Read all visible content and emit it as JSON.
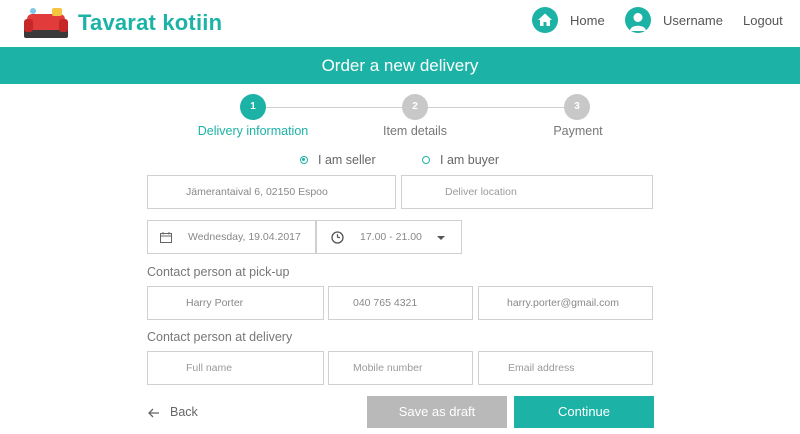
{
  "header": {
    "brand": "Tavarat kotiin",
    "nav": {
      "home": "Home",
      "username": "Username",
      "logout": "Logout"
    }
  },
  "banner": {
    "title": "Order a new delivery"
  },
  "stepper": {
    "steps": [
      {
        "number": "1",
        "label": "Delivery information",
        "state": "active"
      },
      {
        "number": "2",
        "label": "Item details",
        "state": "inactive"
      },
      {
        "number": "3",
        "label": "Payment",
        "state": "inactive"
      }
    ]
  },
  "role": {
    "options": [
      {
        "label": "I am seller",
        "checked": true
      },
      {
        "label": "I am buyer",
        "checked": false
      }
    ]
  },
  "locations": {
    "pickup": {
      "value": "Jämerantaival 6, 02150 Espoo",
      "placeholder": ""
    },
    "deliver": {
      "value": "",
      "placeholder": "Deliver location"
    }
  },
  "schedule": {
    "date": "Wednesday, 19.04.2017",
    "time": "17.00 - 21.00"
  },
  "pickup_contact": {
    "label": "Contact person at pick-up",
    "name": "Harry Porter",
    "phone": "040 765 4321",
    "email": "harry.porter@gmail.com"
  },
  "delivery_contact": {
    "label": "Contact person at delivery",
    "name_placeholder": "Full name",
    "phone_placeholder": "Mobile number",
    "email_placeholder": "Email address"
  },
  "footer": {
    "back": "Back",
    "draft": "Save as draft",
    "continue": "Continue"
  },
  "colors": {
    "accent": "#1cb3a6",
    "muted_button": "#b9b9b9",
    "border": "#d0d0d0"
  }
}
